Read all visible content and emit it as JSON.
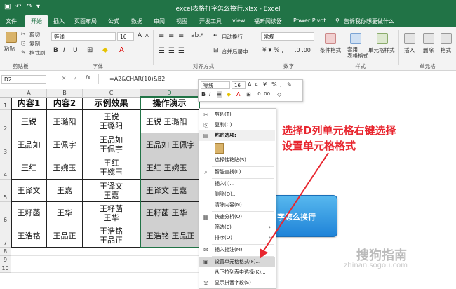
{
  "app": {
    "title": "excel表格打字怎么换行.xlsx - Excel",
    "accent_color": "#217346",
    "annotation_color": "#e8262f"
  },
  "tabs": [
    "文件",
    "开始",
    "插入",
    "页面布局",
    "公式",
    "数据",
    "审阅",
    "视图",
    "开发工具",
    "view",
    "福昕阅读器",
    "Power Pivot"
  ],
  "active_tab": "开始",
  "tell_me": "告诉我你想要做什么",
  "ribbon": {
    "clipboard": {
      "paste": "粘贴",
      "cut": "剪切",
      "copy": "复制",
      "format_painter": "格式刷",
      "label": "剪贴板"
    },
    "font": {
      "name": "等线",
      "size": "16",
      "label": "字体",
      "bold": "B",
      "italic": "I",
      "underline": "U"
    },
    "alignment": {
      "wrap": "自动换行",
      "merge": "合并后居中",
      "label": "对齐方式"
    },
    "number": {
      "format": "常规",
      "label": "数字"
    },
    "styles": {
      "conditional": "条件格式",
      "table": "套用\n表格格式",
      "cell_styles": "单元格样式",
      "label": "样式"
    },
    "cells": {
      "insert": "插入",
      "delete": "删除",
      "format": "格式",
      "label": "单元格"
    }
  },
  "formula_bar": {
    "name_box": "D2",
    "fx": "fx",
    "formula": "=A2&CHAR(10)&B2"
  },
  "sheet": {
    "columns": [
      "A",
      "B",
      "C",
      "D"
    ],
    "rows": [
      "1",
      "2",
      "3",
      "4",
      "5",
      "6",
      "7",
      "8",
      "9",
      "10"
    ],
    "header": [
      "内容1",
      "内容2",
      "示例效果",
      "操作演示"
    ],
    "data": [
      {
        "a": "王锐",
        "b": "王璐阳",
        "c": "王锐\n王璐阳",
        "d": "王锐 王璐阳"
      },
      {
        "a": "王品如",
        "b": "王佩宇",
        "c": "王品如\n王佩宇",
        "d": "王品如 王佩宇"
      },
      {
        "a": "王红",
        "b": "王婉玉",
        "c": "王红\n王婉玉",
        "d": "王红 王婉玉"
      },
      {
        "a": "王译文",
        "b": "王嘉",
        "c": "王译文\n王嘉",
        "d": "王译文 王嘉"
      },
      {
        "a": "王籽菡",
        "b": "王华",
        "c": "王籽菡\n王华",
        "d": "王籽菡 王华"
      },
      {
        "a": "王浩铭",
        "b": "王品正",
        "c": "王浩铭\n王品正",
        "d": "王浩铭 王品正"
      }
    ]
  },
  "mini_toolbar": {
    "font": "等线",
    "size": "16",
    "percent": "%",
    "comma": ","
  },
  "context_menu": {
    "items": [
      {
        "label": "剪切(T)",
        "icon": "scissors-icon"
      },
      {
        "label": "复制(C)",
        "icon": "copy-icon"
      },
      {
        "label": "粘贴选项:",
        "icon": "paste-icon"
      },
      {
        "label": "选择性粘贴(S)...",
        "icon": ""
      },
      {
        "label": "智能查找(L)",
        "icon": "search-icon"
      },
      {
        "label": "插入(I)...",
        "icon": ""
      },
      {
        "label": "删除(D)...",
        "icon": ""
      },
      {
        "label": "清除内容(N)",
        "icon": ""
      },
      {
        "label": "快速分析(Q)",
        "icon": "quick-analysis-icon"
      },
      {
        "label": "筛选(E)",
        "icon": ""
      },
      {
        "label": "排序(O)",
        "icon": ""
      },
      {
        "label": "插入批注(M)",
        "icon": "comment-icon"
      },
      {
        "label": "设置单元格格式(F)...",
        "icon": "format-cells-icon"
      },
      {
        "label": "从下拉列表中选择(K)...",
        "icon": ""
      },
      {
        "label": "显示拼音字段(S)",
        "icon": "pinyin-icon"
      }
    ]
  },
  "annotation": {
    "text": "选择D列单元格右键选择\n设置单元格格式"
  },
  "blue_button": {
    "text": "字怎么换行"
  },
  "watermark": {
    "text": "搜狗指南",
    "url": "zhinan.sogou.com"
  }
}
